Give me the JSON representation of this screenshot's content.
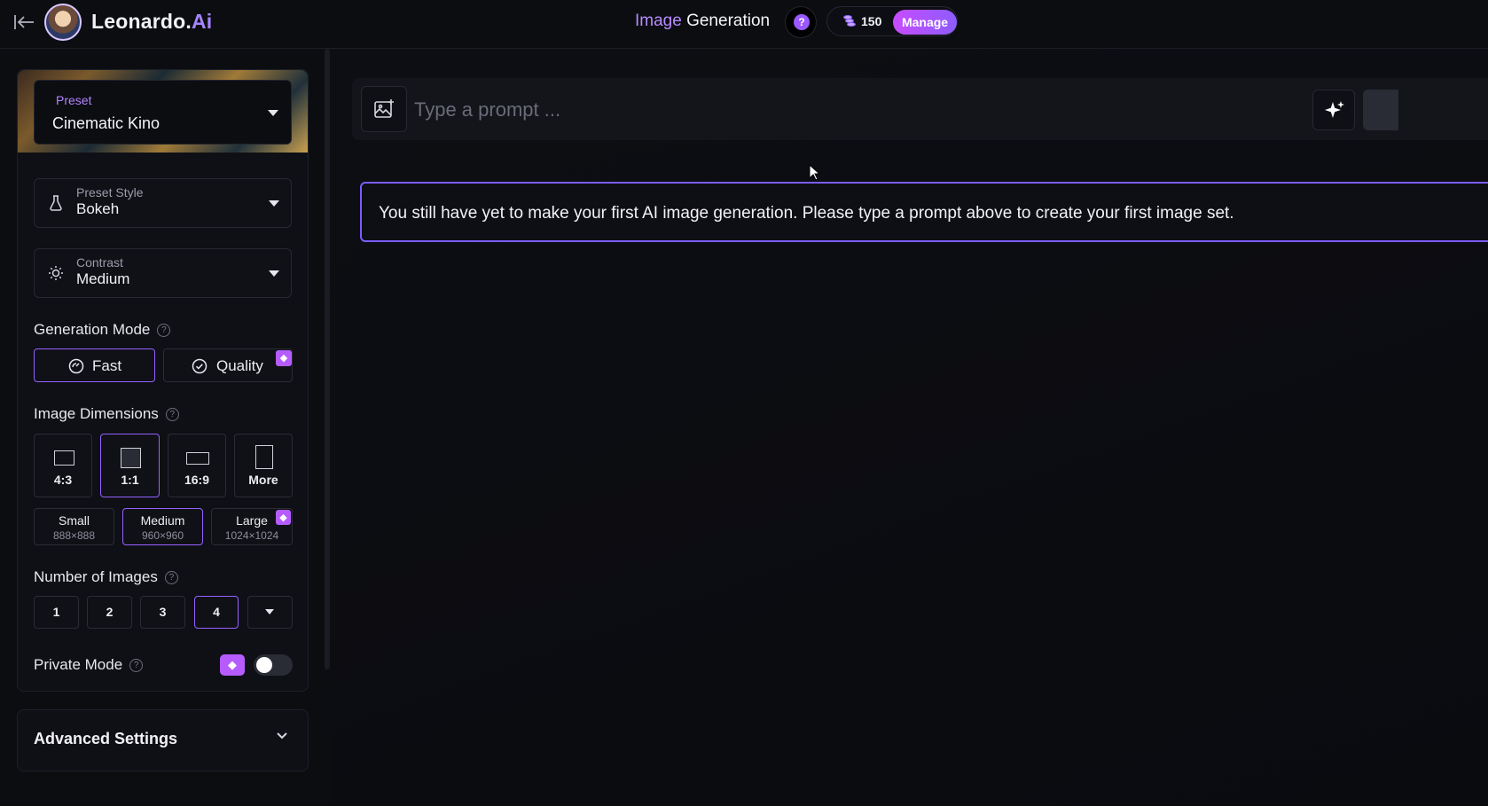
{
  "header": {
    "brand": "Leonardo.",
    "brand_accent": "Ai",
    "title_accent": "Image",
    "title_rest": " Generation",
    "help_icon": "?",
    "credits": "150",
    "manage_label": "Manage"
  },
  "sidebar": {
    "preset": {
      "label": "Preset",
      "value": "Cinematic Kino"
    },
    "preset_style": {
      "label": "Preset Style",
      "value": "Bokeh"
    },
    "contrast": {
      "label": "Contrast",
      "value": "Medium"
    },
    "generation_mode": {
      "title": "Generation Mode",
      "options": [
        {
          "label": "Fast",
          "active": true
        },
        {
          "label": "Quality",
          "active": false,
          "premium": true
        }
      ]
    },
    "image_dimensions": {
      "title": "Image Dimensions",
      "ratios": [
        {
          "label": "4:3",
          "active": false
        },
        {
          "label": "1:1",
          "active": true
        },
        {
          "label": "16:9",
          "active": false
        },
        {
          "label": "More",
          "active": false
        }
      ],
      "sizes": [
        {
          "label": "Small",
          "dims": "888×888",
          "active": false
        },
        {
          "label": "Medium",
          "dims": "960×960",
          "active": true
        },
        {
          "label": "Large",
          "dims": "1024×1024",
          "active": false,
          "premium": true
        }
      ]
    },
    "number_of_images": {
      "title": "Number of Images",
      "options": [
        "1",
        "2",
        "3",
        "4"
      ],
      "selected": "4"
    },
    "private_mode": {
      "title": "Private Mode",
      "enabled": false
    },
    "advanced": {
      "title": "Advanced Settings"
    }
  },
  "main": {
    "prompt_placeholder": "Type a prompt ...",
    "notice": "You still have yet to make your first AI image generation. Please type a prompt above to create your first image set."
  },
  "colors": {
    "accent": "#9561ff",
    "brand_accent": "#a585ff",
    "premium": "#b65cff",
    "background": "#0c0d11"
  },
  "icons": [
    "back-arrow-icon",
    "avatar-logo",
    "help-icon",
    "coins-icon",
    "flask-icon",
    "sun-icon",
    "gauge-icon",
    "check-circle-icon",
    "gem-icon",
    "image-add-icon",
    "sparkle-icon",
    "chevron-down-icon"
  ]
}
